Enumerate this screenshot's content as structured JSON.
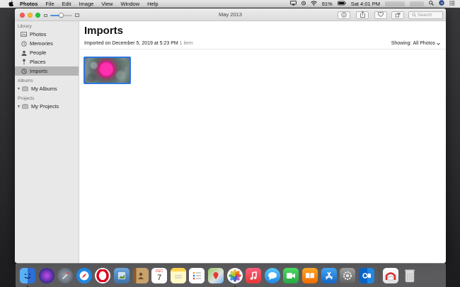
{
  "menubar": {
    "app_name": "Photos",
    "menus": [
      "File",
      "Edit",
      "Image",
      "View",
      "Window",
      "Help"
    ],
    "battery": "91%",
    "clock": "Sat 4:01 PM"
  },
  "window": {
    "title": "May 2013",
    "search_placeholder": "Search",
    "zoom_level": 0.5
  },
  "sidebar": {
    "library_header": "Library",
    "items": [
      {
        "label": "Photos",
        "icon": "photos-icon"
      },
      {
        "label": "Memories",
        "icon": "memories-icon"
      },
      {
        "label": "People",
        "icon": "people-icon"
      },
      {
        "label": "Places",
        "icon": "places-icon"
      },
      {
        "label": "Imports",
        "icon": "imports-icon"
      }
    ],
    "albums_header": "Albums",
    "my_albums": "My Albums",
    "projects_header": "Projects",
    "my_projects": "My Projects"
  },
  "main": {
    "heading": "Imports",
    "imported_prefix": "Imported on",
    "imported_date": "December 5, 2019 at 5:23 PM",
    "item_count": "1 item",
    "showing_label": "Showing:",
    "showing_value": "All Photos"
  },
  "colors": {
    "accent": "#2f77e0",
    "selection": "#b4b4b4",
    "close": "#fc5f57",
    "minimize": "#fdbc2e",
    "maximize": "#28c840"
  },
  "dock": {
    "icons": [
      "finder-icon",
      "siri-icon",
      "launchpad-icon",
      "safari-icon",
      "opera-icon",
      "preview-icon",
      "contacts-icon",
      "calendar-icon",
      "notes-icon",
      "reminders-icon",
      "maps-icon",
      "photos-app-icon",
      "music-icon",
      "messages-icon",
      "facetime-icon",
      "books-icon",
      "app-store-icon",
      "system-preferences-icon",
      "outlook-icon",
      "downloads-stack-icon",
      "trash-icon"
    ],
    "calendar_month": "DEC",
    "calendar_day": "7"
  }
}
